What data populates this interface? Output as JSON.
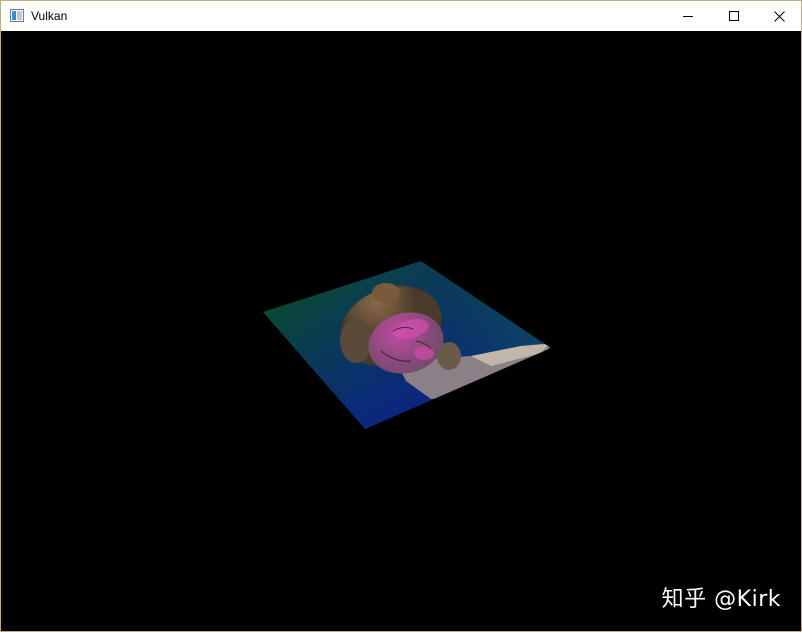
{
  "window": {
    "title": "Vulkan",
    "app_icon": "window-app-icon",
    "controls": {
      "minimize_icon": "minimize-icon",
      "maximize_icon": "maximize-icon",
      "close_icon": "close-icon"
    }
  },
  "viewport": {
    "background": "#000000",
    "scene": "textured-quad",
    "watermark_text": "知乎 @Kirk"
  }
}
